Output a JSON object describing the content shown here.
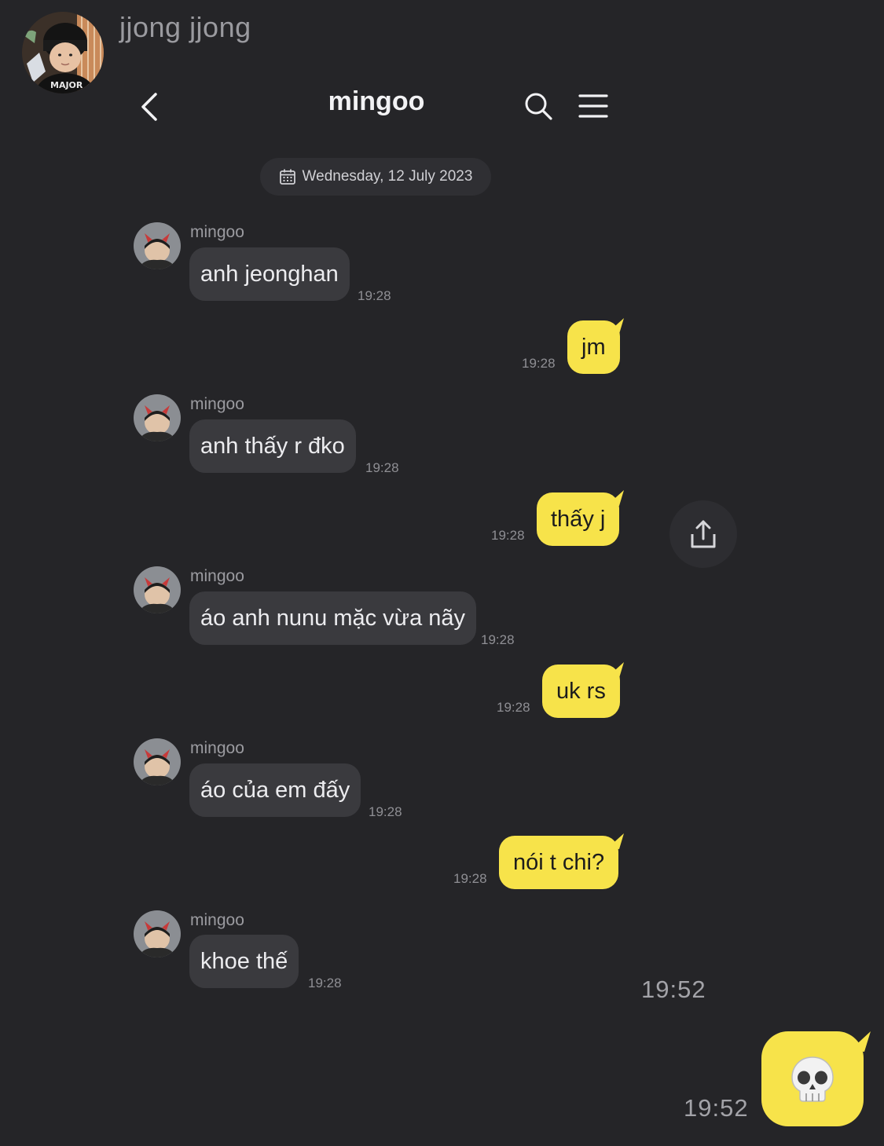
{
  "outer": {
    "sender_name": "jjong jjong",
    "avatar_shirt_text": "MAJOR"
  },
  "chat": {
    "title": "mingoo",
    "date_label": "Wednesday, 12 July 2023"
  },
  "messages": [
    {
      "direction": "in",
      "sender": "mingoo",
      "text": "anh jeonghan",
      "time": "19:28"
    },
    {
      "direction": "out",
      "text": "jm",
      "time": "19:28"
    },
    {
      "direction": "in",
      "sender": "mingoo",
      "text": "anh thấy r đko",
      "time": "19:28"
    },
    {
      "direction": "out",
      "text": "thấy j",
      "time": "19:28"
    },
    {
      "direction": "in",
      "sender": "mingoo",
      "text": "áo anh nunu mặc vừa nãy",
      "time": "19:28"
    },
    {
      "direction": "out",
      "text": "uk rs",
      "time": "19:28"
    },
    {
      "direction": "in",
      "sender": "mingoo",
      "text": "áo của em đấy",
      "time": "19:28"
    },
    {
      "direction": "out",
      "text": "nói t chi?",
      "time": "19:28"
    },
    {
      "direction": "in",
      "sender": "mingoo",
      "text": "khoe thế",
      "time": "19:28"
    }
  ],
  "outer_times": [
    "19:52",
    "19:52"
  ],
  "reaction_emoji": "💀",
  "colors": {
    "background": "#252528",
    "incoming_bubble": "#3a3a3e",
    "outgoing_bubble": "#f7e34a"
  },
  "icons": {
    "back": "chevron-left-icon",
    "search": "search-icon",
    "menu": "hamburger-menu-icon",
    "calendar": "calendar-icon",
    "share": "share-icon"
  }
}
